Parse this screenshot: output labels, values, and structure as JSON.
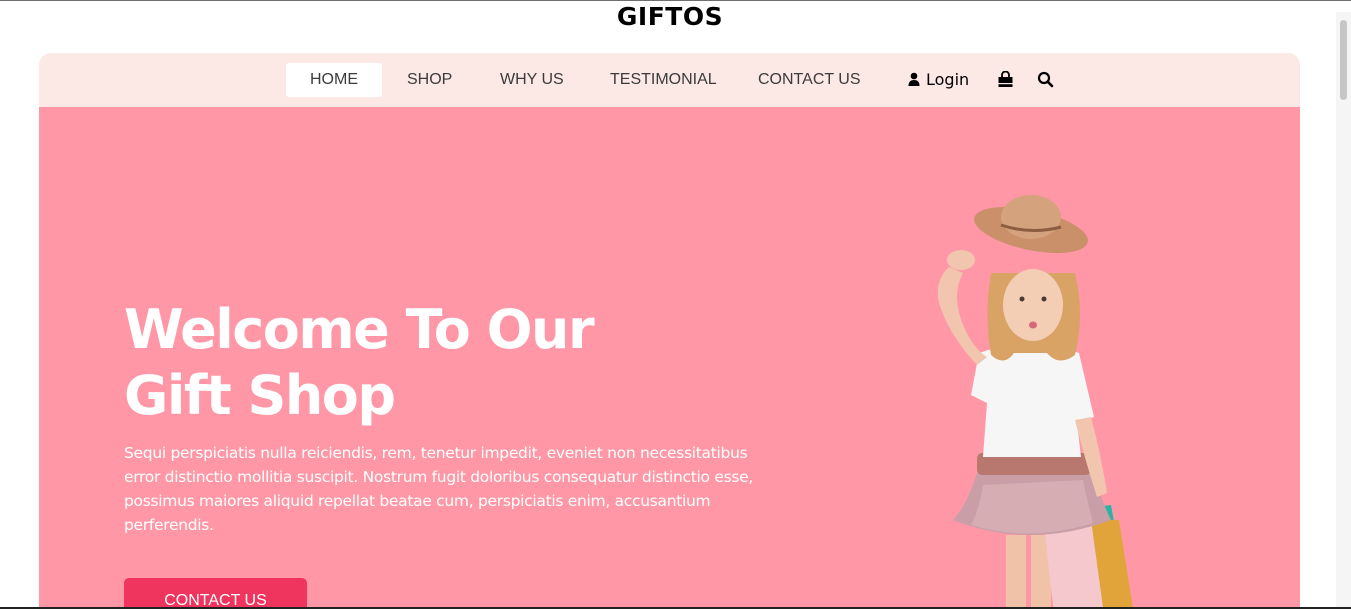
{
  "brand": {
    "name": "GIFTOS"
  },
  "nav": {
    "items": [
      {
        "label": "HOME",
        "active": true
      },
      {
        "label": "SHOP"
      },
      {
        "label": "WHY US"
      },
      {
        "label": "TESTIMONIAL"
      },
      {
        "label": "CONTACT US"
      }
    ],
    "login_label": "Login",
    "icons": [
      "user-icon",
      "shopping-bag-icon",
      "search-icon"
    ]
  },
  "hero": {
    "title_line1": "Welcome To Our",
    "title_line2": "Gift Shop",
    "text": "Sequi perspiciatis nulla reiciendis, rem, tenetur impedit, eveniet non necessitatibus error distinctio mollitia suscipit. Nostrum fugit doloribus consequatur distinctio esse, possimus maiores aliquid repellat beatae cum, perspiciatis enim, accusantium perferendis.",
    "button_label": "CONTACT US"
  },
  "colors": {
    "nav_bg": "#fce8e4",
    "hero_bg": "#ff97a6",
    "button_bg": "#ef345e",
    "text_light": "#ffffff"
  }
}
